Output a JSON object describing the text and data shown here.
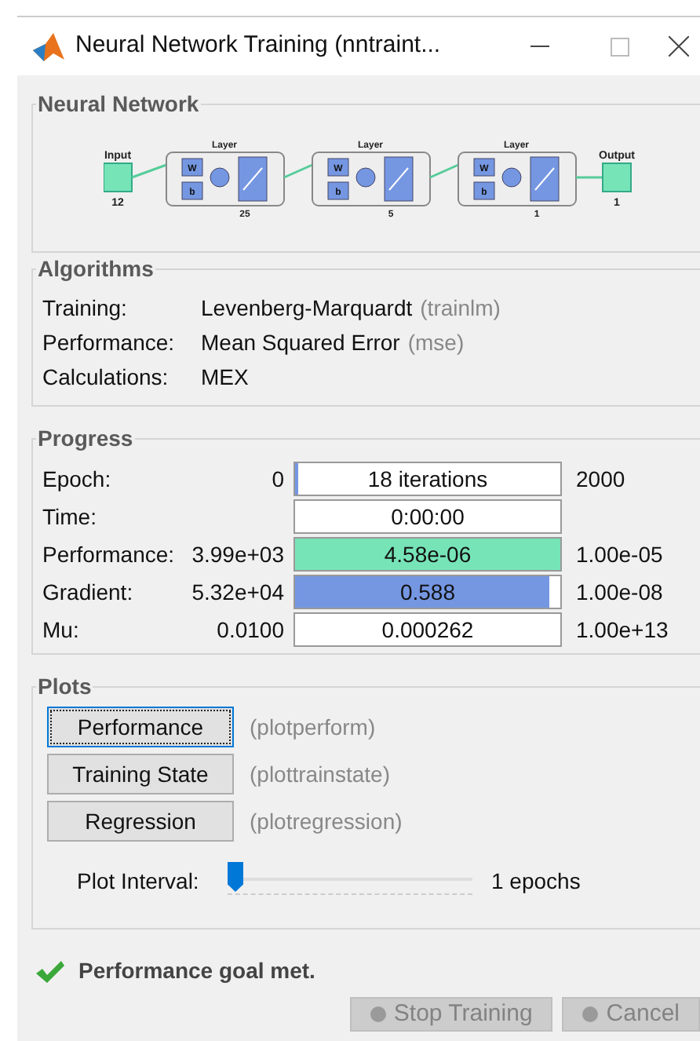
{
  "window": {
    "title": "Neural Network Training (nntraint..."
  },
  "network": {
    "title": "Neural Network",
    "input": {
      "label": "Input",
      "size": "12"
    },
    "output": {
      "label": "Output",
      "size": "1"
    },
    "layers": [
      {
        "title": "Layer",
        "size": "25",
        "weight": "W",
        "bias": "b"
      },
      {
        "title": "Layer",
        "size": "5",
        "weight": "W",
        "bias": "b"
      },
      {
        "title": "Layer",
        "size": "1",
        "weight": "W",
        "bias": "b"
      }
    ]
  },
  "algorithms": {
    "title": "Algorithms",
    "rows": [
      {
        "label": "Training:",
        "value": "Levenberg-Marquardt",
        "code": "(trainlm)"
      },
      {
        "label": "Performance:",
        "value": "Mean Squared Error",
        "code": "(mse)"
      },
      {
        "label": "Calculations:",
        "value": "MEX"
      }
    ]
  },
  "progress": {
    "title": "Progress",
    "rows": [
      {
        "label": "Epoch:",
        "start": "0",
        "bar": "18 iterations",
        "end": "2000",
        "level": 0.01,
        "color": "#7597e2"
      },
      {
        "label": "Time:",
        "bar": "0:00:00"
      },
      {
        "label": "Performance:",
        "start": "3.99e+03",
        "bar": "4.58e-06",
        "end": "1.00e-05",
        "level": 1,
        "color": "#77e4b8"
      },
      {
        "label": "Gradient:",
        "start": "5.32e+04",
        "bar": "0.588",
        "end": "1.00e-08",
        "level": 0.96,
        "color": "#7597e2"
      },
      {
        "label": "Mu:",
        "start": "0.0100",
        "bar": "0.000262",
        "end": "1.00e+13"
      }
    ]
  },
  "plots": {
    "title": "Plots",
    "buttons": [
      {
        "label": "Performance",
        "code": "(plotperform)",
        "focused": true
      },
      {
        "label": "Training State",
        "code": "(plottrainstate)",
        "focused": false
      },
      {
        "label": "Regression",
        "code": "(plotregression)",
        "focused": false
      }
    ],
    "interval": {
      "label": "Plot Interval:",
      "level": 0,
      "reading": "1 epochs"
    }
  },
  "status": "Performance goal met.",
  "buttons": [
    {
      "label": "Stop Training",
      "disabled": true
    },
    {
      "label": "Cancel",
      "disabled": true
    }
  ]
}
